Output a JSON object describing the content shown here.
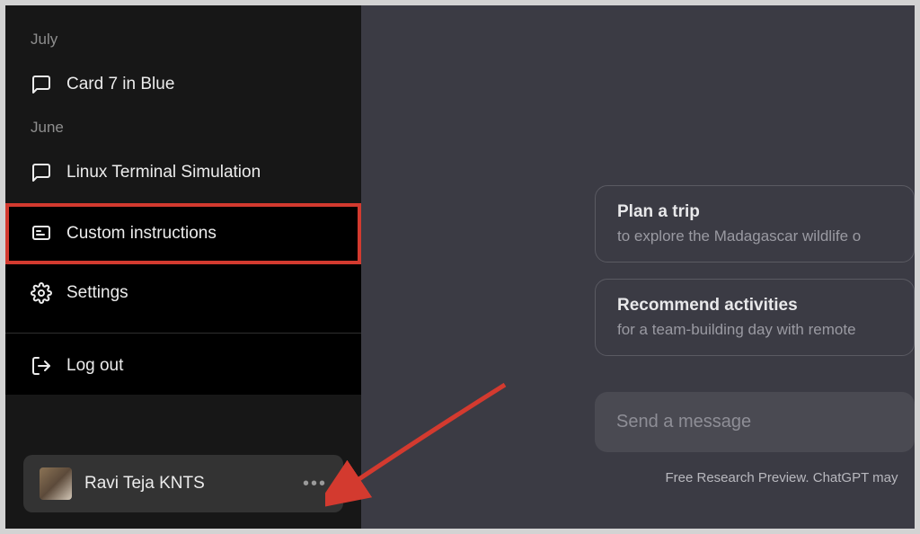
{
  "sidebar": {
    "months": {
      "july": "July",
      "june": "June"
    },
    "chats": {
      "july_item": "Card 7 in Blue",
      "june_item": "Linux Terminal Simulation"
    },
    "menu": {
      "custom_instructions": "Custom instructions",
      "settings": "Settings",
      "logout": "Log out"
    },
    "user": {
      "name": "Ravi Teja KNTS",
      "more": "…"
    }
  },
  "main": {
    "suggestions": [
      {
        "title": "Plan a trip",
        "subtitle": "to explore the Madagascar wildlife o"
      },
      {
        "title": "Recommend activities",
        "subtitle": "for a team-building day with remote"
      }
    ],
    "input_placeholder": "Send a message",
    "footer": "Free Research Preview. ChatGPT may"
  }
}
